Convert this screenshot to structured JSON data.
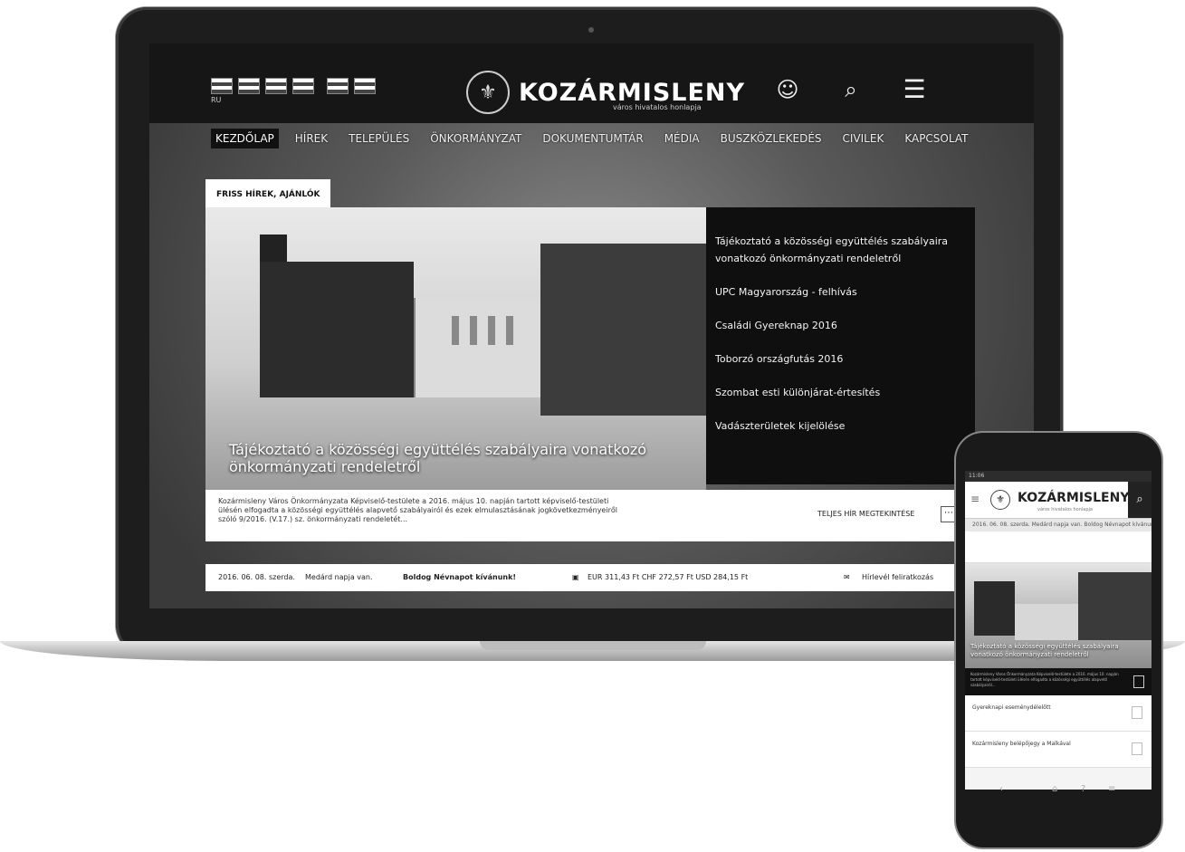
{
  "laptop": {
    "header": {
      "language_label": "RU",
      "site_title": "KOZÁRMISLENY",
      "site_subtitle": "város hivatalos honlapja",
      "accessibility_icon": "accessibility-icon",
      "search_icon": "search-icon",
      "menu_icon": "hamburger-menu-icon"
    },
    "nav": [
      "KEZDŐLAP",
      "HÍREK",
      "TELEPÜLÉS",
      "ÖNKORMÁNYZAT",
      "DOKUMENTUMTÁR",
      "MÉDIA",
      "BUSZKÖZLEKEDÉS",
      "CIVILEK",
      "KAPCSOLAT"
    ],
    "news": {
      "tab_label": "FRISS HÍREK, AJÁNLÓK",
      "hero_caption": "Tájékoztató a közösségi együttélés szabályaira vonatkozó önkormányzati rendeletről",
      "side_items": [
        "Tájékoztató a közösségi együttélés szabályaira vonatkozó önkormányzati rendeletről",
        "UPC Magyarország - felhívás",
        "Családi Gyereknap 2016",
        "Toborzó országfutás 2016",
        "Szombat esti különjárat-értesítés",
        "Vadászterületek kijelölése"
      ],
      "excerpt": "Kozármisleny Város Önkormányzata Képviselő-testülete a 2016. május 10. napján tartott képviselő-testületi ülésén elfogadta a közösségi együttélés alapvető szabályairól és ezek elmulasztásának jogkövetkezményeiről szóló 9/2016. (V.17.) sz. önkormányzati rendeletét...",
      "readmore": "TELJES HÍR MEGTEKINTÉSE"
    },
    "infobar": {
      "date": "2016. 06. 08. szerda.",
      "nameday": "Medárd napja van.",
      "greeting": "Boldog Névnapot kívánunk!",
      "rates": "EUR 311,43 Ft  CHF 272,57 Ft  USD 284,15 Ft",
      "newsletter": "Hírlevél feliratkozás"
    }
  },
  "phone": {
    "status": "11:06",
    "site_title": "KOZÁRMISLENY",
    "site_subtitle": "város hivatalos honlapja",
    "ticker": "2016. 06. 08. szerda. Medárd napja van. Boldog Névnapot kívánunk!",
    "hero_caption": "Tájékoztató a közösségi együttélés szabályaira vonatkozó önkormányzati rendeletről",
    "excerpt": "Kozármisleny Város Önkormányzata Képviselő-testülete a 2016. május 10. napján tartott képviselő-testületi ülésén elfogadta a közösségi együttélés alapvető szabályairól...",
    "items": [
      "Gyereknapi eseménydélelőtt",
      "Kozármisleny belépőjegy a Malkával"
    ],
    "nav": [
      "‹",
      "⌂",
      "?",
      "≡"
    ]
  }
}
